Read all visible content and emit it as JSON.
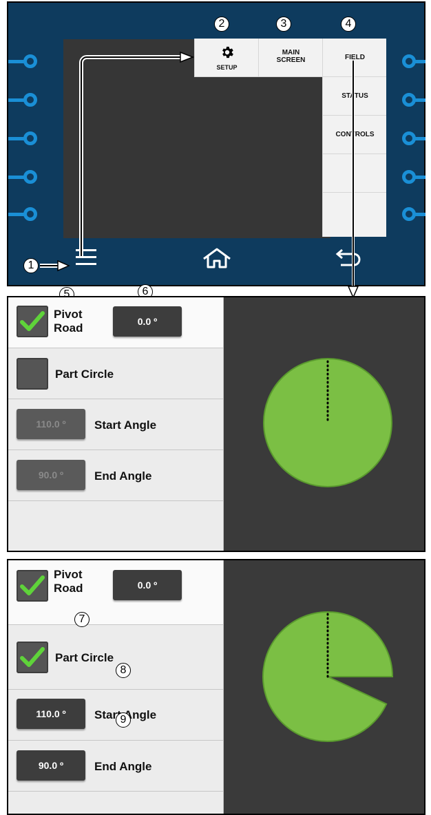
{
  "callouts": [
    "1",
    "2",
    "3",
    "4",
    "5",
    "6",
    "7",
    "8",
    "9"
  ],
  "menu": {
    "setup_label": "SETUP",
    "main_screen_label": "MAIN\nSCREEN",
    "field_label": "FIELD",
    "status_label": "STATUS",
    "controls_label": "CONTROLS"
  },
  "icons": {
    "gear": "gear-icon",
    "hamburger": "hamburger-menu-icon",
    "home": "home-icon",
    "back": "back-arrow-icon",
    "checkmark": "checkmark-icon"
  },
  "colors": {
    "bezel": "#0e3b5e",
    "port": "#1a8fd6",
    "field_green": "#7bbf44",
    "check_green": "#5fd33a"
  },
  "before": {
    "pivot_road_label": "Pivot\nRoad",
    "pivot_road_checked": true,
    "pivot_road_value": "0.0 º",
    "part_circle_label": "Part Circle",
    "part_circle_checked": false,
    "start_angle_value": "110.0 º",
    "start_angle_label": "Start Angle",
    "end_angle_value": "90.0 º",
    "end_angle_label": "End Angle"
  },
  "after": {
    "pivot_road_label": "Pivot\nRoad",
    "pivot_road_checked": true,
    "pivot_road_value": "0.0 º",
    "part_circle_label": "Part Circle",
    "part_circle_checked": true,
    "start_angle_value": "110.0 º",
    "start_angle_label": "Start Angle",
    "end_angle_value": "90.0 º",
    "end_angle_label": "End Angle"
  }
}
